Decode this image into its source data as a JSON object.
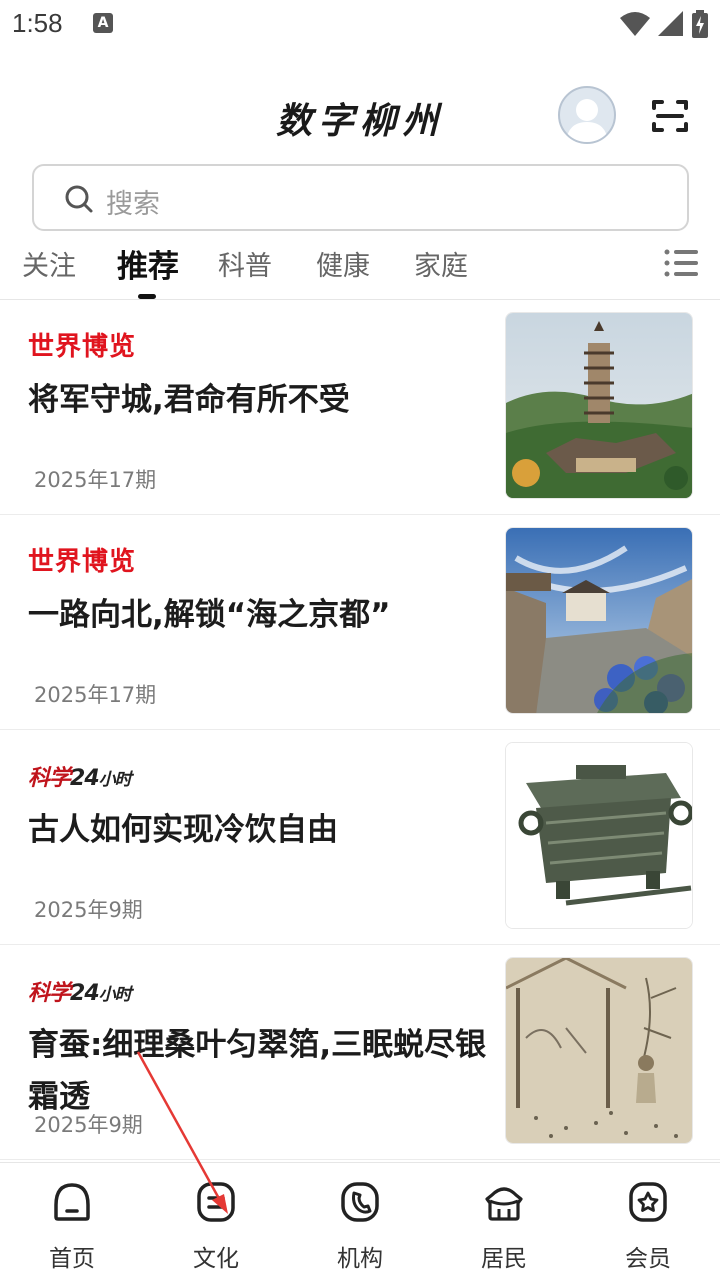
{
  "status_bar": {
    "time": "1:58",
    "notif_letter": "A"
  },
  "header": {
    "logo_text": "数字柳州"
  },
  "search": {
    "placeholder": "搜索"
  },
  "tabs": [
    {
      "label": "关注"
    },
    {
      "label": "推荐",
      "active": true
    },
    {
      "label": "科普"
    },
    {
      "label": "健康"
    },
    {
      "label": "家庭"
    }
  ],
  "articles": [
    {
      "source": "世界博览",
      "title": "将军守城,君命有所不受",
      "issue": "2025年17期"
    },
    {
      "source": "世界博览",
      "title": "一路向北,解锁“海之京都”",
      "issue": "2025年17期"
    },
    {
      "source": "科学24小时",
      "title": "古人如何实现冷饮自由",
      "issue": "2025年9期"
    },
    {
      "source": "科学24小时",
      "title": "育蚕:细理桑叶匀翠箔,三眠蜕尽银霜透",
      "issue": "2025年9期"
    }
  ],
  "source_logo": {
    "part1": "科学",
    "part2": "24",
    "part3": "小时"
  },
  "bottom_nav": [
    {
      "label": "首页"
    },
    {
      "label": "文化"
    },
    {
      "label": "机构"
    },
    {
      "label": "居民"
    },
    {
      "label": "会员"
    }
  ],
  "colors": {
    "source_red": "#e0141e",
    "annotation_arrow": "#e53935"
  }
}
